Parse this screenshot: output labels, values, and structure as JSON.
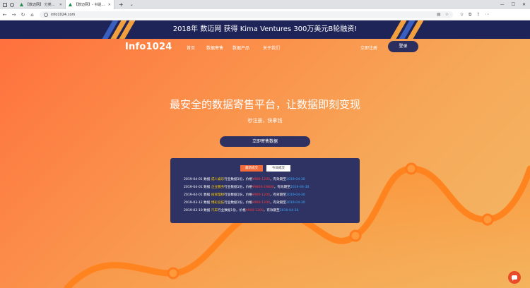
{
  "browser": {
    "tabs": [
      {
        "title": "【数迈网】 分类列表(数据)",
        "active": false
      },
      {
        "title": "【数迈网】- 书说与数据",
        "active": true
      }
    ],
    "url": "info1024.com"
  },
  "banner": {
    "text": "2018年 数迈网 获得 Kima Ventures 300万美元B轮融资!"
  },
  "nav": {
    "logo": "Info1024",
    "items": [
      "首页",
      "数据寄售",
      "数据产品",
      "关于我们"
    ],
    "register": "立即注册",
    "login": "登录"
  },
  "hero": {
    "title": "最安全的数据寄售平台，让数据即刻变现",
    "subtitle": "秒注册，快拿钱",
    "cta": "立即寄售数据"
  },
  "panel": {
    "tabs": [
      "最新成交",
      "今日成交"
    ],
    "rows": [
      {
        "date": "2019-04-01",
        "t1": " 数据 ",
        "cat": "成人娱乐",
        "t2": "行业数据1份，",
        "price_label": "价格",
        "price": "¥900-1200",
        "t3": "，有效期至",
        "expiry": "2019-04-30",
        "t4": ""
      },
      {
        "date": "2019-04-01",
        "t1": " 数据 ",
        "cat": "企业服务",
        "t2": "行业数据1份，",
        "price_label": "价格",
        "price": "¥9800-19800",
        "t3": "，有效期至",
        "expiry": "2019-04-30",
        "t4": ""
      },
      {
        "date": "2019-04-01",
        "t1": " 数据 ",
        "cat": "投资理财",
        "t2": "行业数据1份，",
        "price_label": "价格",
        "price": "¥900-1200",
        "t3": "，有效期至",
        "expiry": "2019-04-30",
        "t4": ""
      },
      {
        "date": "2019-03-12",
        "t1": " 数据 ",
        "cat": "博彩竞技",
        "t2": "行业数据1份，",
        "price_label": "价格",
        "price": "¥900-1200",
        "t3": "，有效期至",
        "expiry": "2019-04-30",
        "t4": ""
      },
      {
        "date": "2019-03-10",
        "t1": " 数据 ",
        "cat": "汽车",
        "t2": "行业数据1份，",
        "price_label": "价格",
        "price": "¥900-1200",
        "t3": "，有效期至",
        "expiry": "2019-04-30",
        "t4": ""
      }
    ]
  },
  "colors": {
    "banner_bg": "#1f2458",
    "accent": "#f26b3a",
    "panel_bg": "#2f3363",
    "highlight": "#ffd000",
    "price": "#ff3b3b",
    "date": "#3aa9ff"
  }
}
